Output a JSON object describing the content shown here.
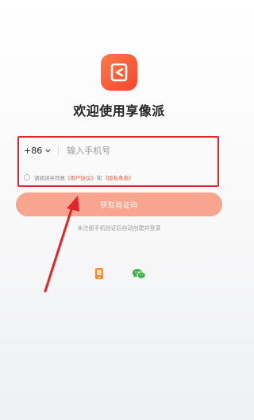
{
  "app": {
    "welcome_title": "欢迎使用享像派"
  },
  "login": {
    "country_code": "+86",
    "phone_placeholder": "输入手机号",
    "phone_value": "",
    "agreement": {
      "prefix": "请阅读并同意",
      "user_agreement": "《用户协议》",
      "and": "和",
      "privacy_policy": "《隐私条款》"
    },
    "get_code_button": "获取验证码",
    "hint": "未注册手机验证后自动创建并登录"
  },
  "other_login": {
    "icons": [
      "phone-login-icon",
      "wechat-icon"
    ]
  },
  "colors": {
    "accent": "#f0472d",
    "button": "#f8a48f",
    "annotation_red": "#e0262a",
    "wechat_green": "#3bb54a",
    "phone_orange": "#f58a2a"
  }
}
